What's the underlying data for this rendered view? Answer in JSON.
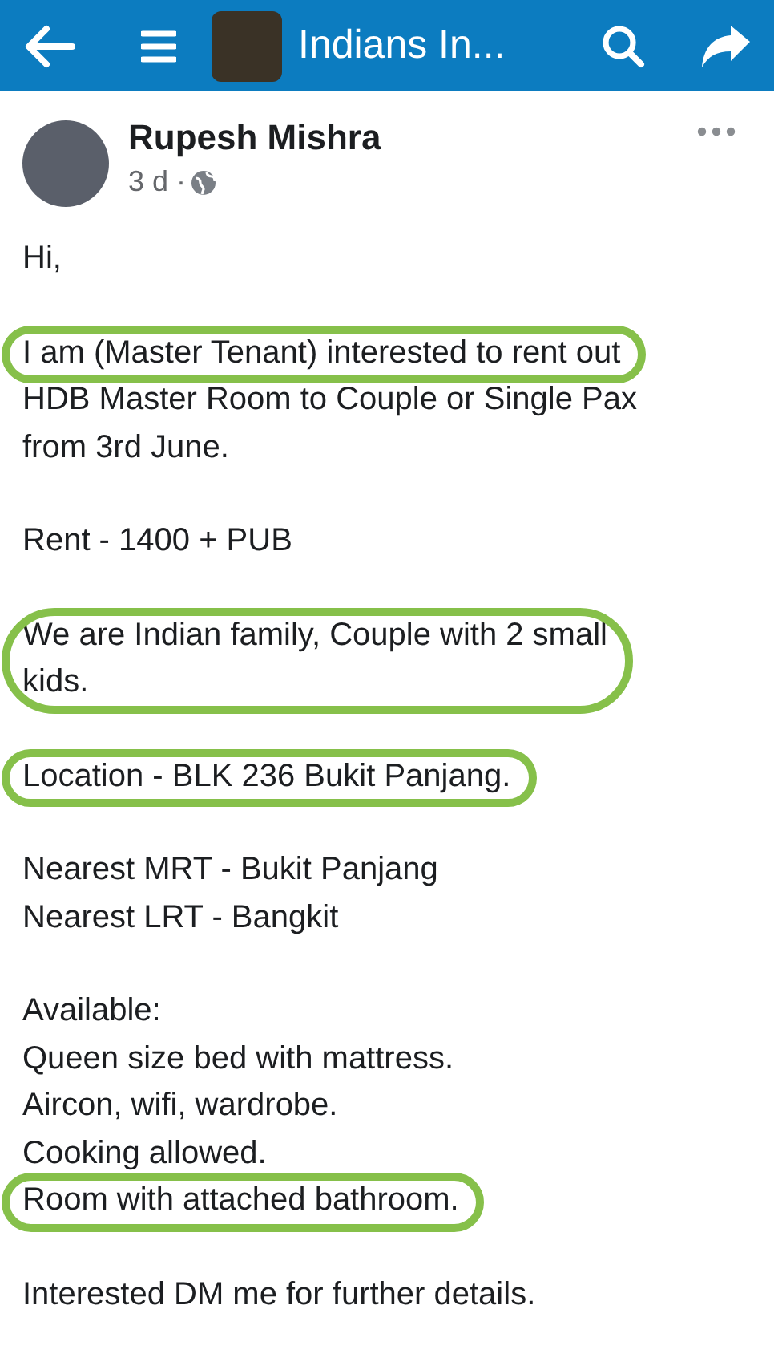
{
  "top_bar": {
    "title": "Indians In..."
  },
  "post": {
    "author": "Rupesh Mishra",
    "time": "3 d ·",
    "paragraphs": [
      {
        "lines": [
          {
            "text": "Hi,",
            "circled": false
          }
        ]
      },
      {
        "lines": [
          {
            "text": "I am (Master Tenant) interested to rent out",
            "circled": true
          },
          {
            "text": "HDB Master Room to Couple or Single Pax\nfrom 3rd June.",
            "circled": false
          }
        ]
      },
      {
        "lines": [
          {
            "text": "Rent - 1400 + PUB",
            "circled": false
          }
        ]
      },
      {
        "lines": [
          {
            "text": "We are Indian family, Couple with 2 small\nkids.",
            "circled": true
          }
        ]
      },
      {
        "lines": [
          {
            "text": "Location - BLK 236 Bukit Panjang.",
            "circled": true
          }
        ]
      },
      {
        "lines": [
          {
            "text": "Nearest MRT - Bukit Panjang",
            "circled": false
          },
          {
            "text": "Nearest LRT - Bangkit",
            "circled": false
          }
        ]
      },
      {
        "lines": [
          {
            "text": "Available:",
            "circled": false
          },
          {
            "text": "Queen size bed with mattress.",
            "circled": false
          },
          {
            "text": "Aircon, wifi, wardrobe.",
            "circled": false
          },
          {
            "text": "Cooking allowed.",
            "circled": false
          },
          {
            "text": "Room with attached bathroom.",
            "circled": true
          }
        ]
      },
      {
        "lines": [
          {
            "text": "Interested DM me for further details.",
            "circled": false
          }
        ]
      }
    ]
  }
}
